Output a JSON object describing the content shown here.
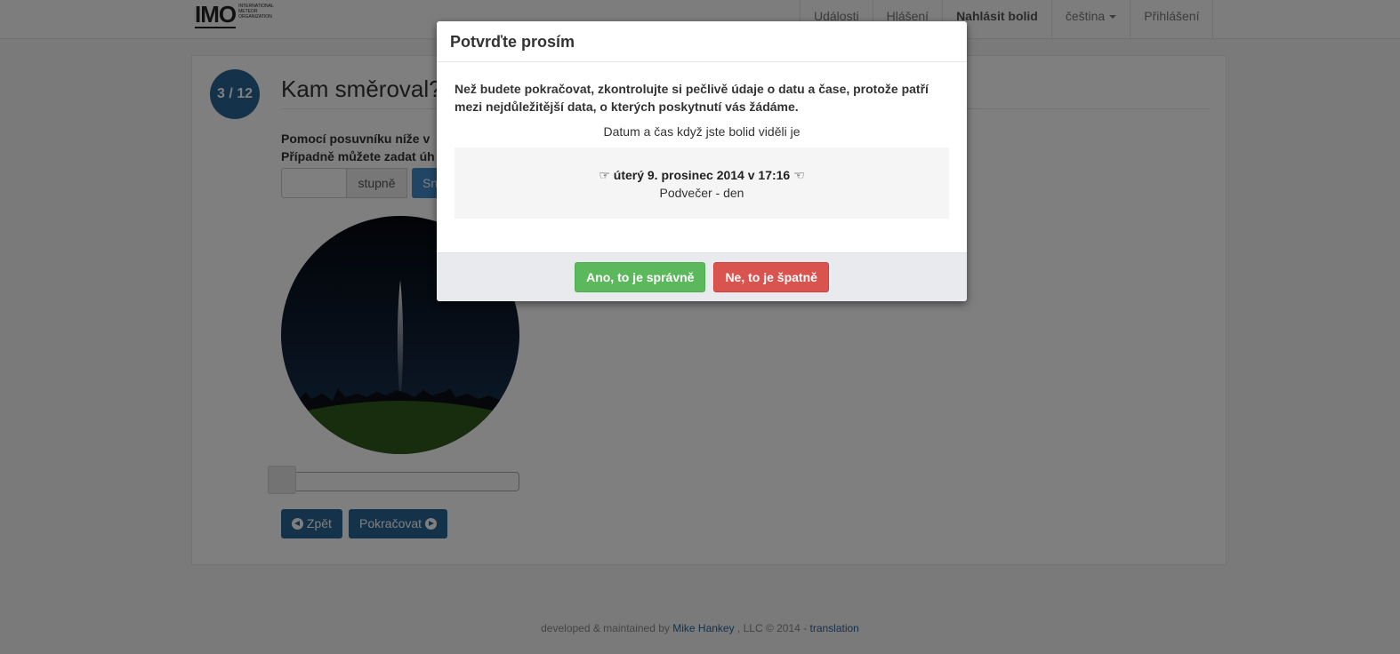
{
  "logo": {
    "mark": "IMO",
    "text": [
      "International",
      "Meteor",
      "Organization"
    ]
  },
  "nav": {
    "items": [
      "Události",
      "Hlášení",
      "Nahlásit bolid",
      "čeština",
      "Přihlášení"
    ]
  },
  "step": {
    "badge": "3 / 12",
    "title": "Kam směroval?",
    "instruction_1": "Pomocí posuvníku níže v",
    "instruction_2": "Případně můžete zadat úh",
    "degrees_addon": "stupně",
    "degrees_button": "Sn",
    "back_label": "Zpět",
    "next_label": "Pokračovat"
  },
  "slider": {
    "value": 0
  },
  "footer": {
    "prefix": "developed & maintained by ",
    "author": "Mike Hankey",
    "middle": " , LLC © 2014 - ",
    "translation": "translation"
  },
  "modal": {
    "title": "Potvrďte prosím",
    "warning": "Než budete pokračovat, zkontrolujte si pečlivě údaje o datu a čase, protože patří mezi nejdůležitější data, o kterých poskytnutí vás žádáme.",
    "subtitle": "Datum a čas když jste bolid viděli je",
    "hand_right": "☞",
    "hand_left": "☜",
    "datetime": "úterý 9. prosinec 2014 v 17:16",
    "period": "Podvečer - den",
    "yes_label": "Ano, to je správně",
    "no_label": "Ne, to je špatně"
  },
  "colors": {
    "primary": "#2a6496",
    "success": "#5cb85c",
    "danger": "#d9534f"
  }
}
